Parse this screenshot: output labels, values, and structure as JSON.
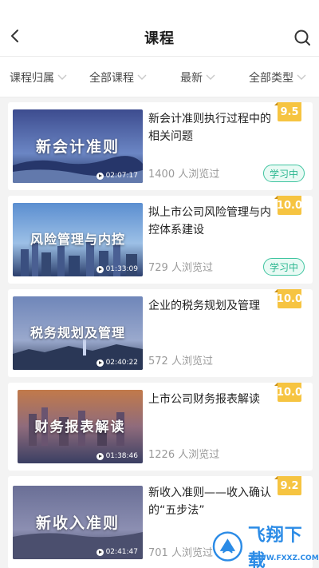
{
  "header": {
    "title": "课程",
    "back_icon": "chevron-left-icon",
    "search_icon": "search-icon"
  },
  "filters": [
    {
      "label": "课程归属"
    },
    {
      "label": "全部课程"
    },
    {
      "label": "最新"
    },
    {
      "label": "全部类型"
    }
  ],
  "courses": [
    {
      "thumb_title": "新会计准则",
      "duration": "02:07:17",
      "title": "新会计准则执行过程中的相关问题",
      "views": "1400 人浏览过",
      "score": "9.5",
      "status": "学习中"
    },
    {
      "thumb_title": "风险管理与内控",
      "duration": "01:33:09",
      "title": "拟上市公司风险管理与内控体系建设",
      "views": "729 人浏览过",
      "score": "10.0",
      "status": "学习中"
    },
    {
      "thumb_title": "税务规划及管理",
      "duration": "02:40:22",
      "title": "企业的税务规划及管理",
      "views": "572 人浏览过",
      "score": "10.0",
      "status": ""
    },
    {
      "thumb_title": "财务报表解读",
      "duration": "01:38:46",
      "title": "上市公司财务报表解读",
      "views": "1226 人浏览过",
      "score": "10.0",
      "status": ""
    },
    {
      "thumb_title": "新收入准则",
      "duration": "02:41:47",
      "title": "新收入准则——收入确认的“五步法”",
      "views": "701 人浏览过",
      "score": "9.2",
      "status": ""
    }
  ],
  "watermark": {
    "text": "飞翔下载",
    "sub": "WWW.FXXZ.COM"
  },
  "colors": {
    "score_bg": "#f6c441",
    "status": "#29b68f",
    "accent": "#2b8be6"
  }
}
